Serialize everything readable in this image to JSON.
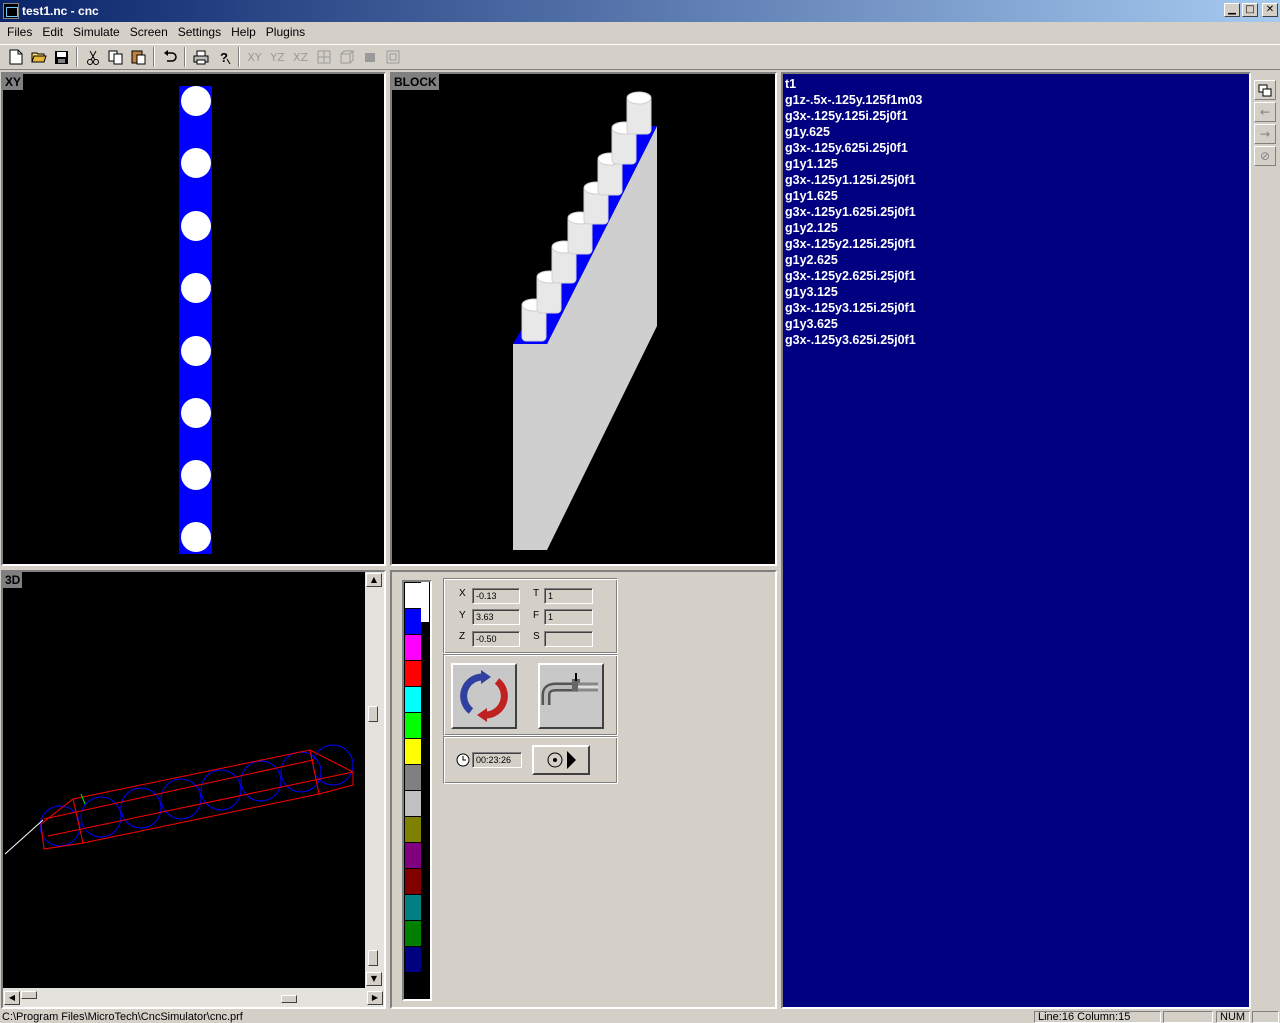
{
  "window": {
    "title": "test1.nc - cnc",
    "minimize_icon": "minimize-icon",
    "maximize_icon": "maximize-icon",
    "close_icon": "close-icon"
  },
  "menu": {
    "items": [
      "Files",
      "Edit",
      "Simulate",
      "Screen",
      "Settings",
      "Help",
      "Plugins"
    ]
  },
  "toolbar": {
    "icons": [
      "new-file-icon",
      "open-folder-icon",
      "save-icon",
      "cut-icon",
      "copy-icon",
      "paste-icon",
      "undo-icon",
      "print-icon",
      "help-icon"
    ],
    "view_labels": [
      "XY",
      "YZ",
      "XZ"
    ]
  },
  "views": {
    "xy_label": "XY",
    "block_label": "BLOCK",
    "threed_label": "3D"
  },
  "code": {
    "lines": [
      "t1",
      "g1z-.5x-.125y.125f1m03",
      "g3x-.125y.125i.25j0f1",
      "g1y.625",
      "g3x-.125y.625i.25j0f1",
      "g1y1.125",
      "g3x-.125y1.125i.25j0f1",
      "g1y1.625",
      "g3x-.125y1.625i.25j0f1",
      "g1y2.125",
      "g3x-.125y2.125i.25j0f1",
      "g1y2.625",
      "g3x-.125y2.625i.25j0f1",
      "g1y3.125",
      "g3x-.125y3.125i.25j0f1",
      "g1y3.625",
      "g3x-.125y3.625i.25j0f1"
    ]
  },
  "coords": {
    "x_label": "X",
    "x_value": "-0.13",
    "y_label": "Y",
    "y_value": "3.63",
    "z_label": "Z",
    "z_value": "-0.50",
    "t_label": "T",
    "t_value": "1",
    "f_label": "F",
    "f_value": "1",
    "s_label": "S",
    "s_value": ""
  },
  "timer": {
    "value": "00:23:26"
  },
  "palette": {
    "colors": [
      "#ffffff",
      "#0000ff",
      "#ff00ff",
      "#ff0000",
      "#00ffff",
      "#00ff00",
      "#ffff00",
      "#808080",
      "#c0c0c0",
      "#808000",
      "#800080",
      "#800000",
      "#008080",
      "#008000",
      "#000080"
    ]
  },
  "statusbar": {
    "path": "C:\\Program Files\\MicroTech\\CncSimulator\\cnc.prf",
    "position": "Line:16 Column:15",
    "num": "NUM"
  },
  "colors": {
    "workpiece_blue": "#0000ff",
    "code_background": "#000080",
    "block_grey": "#cfcfcf"
  }
}
